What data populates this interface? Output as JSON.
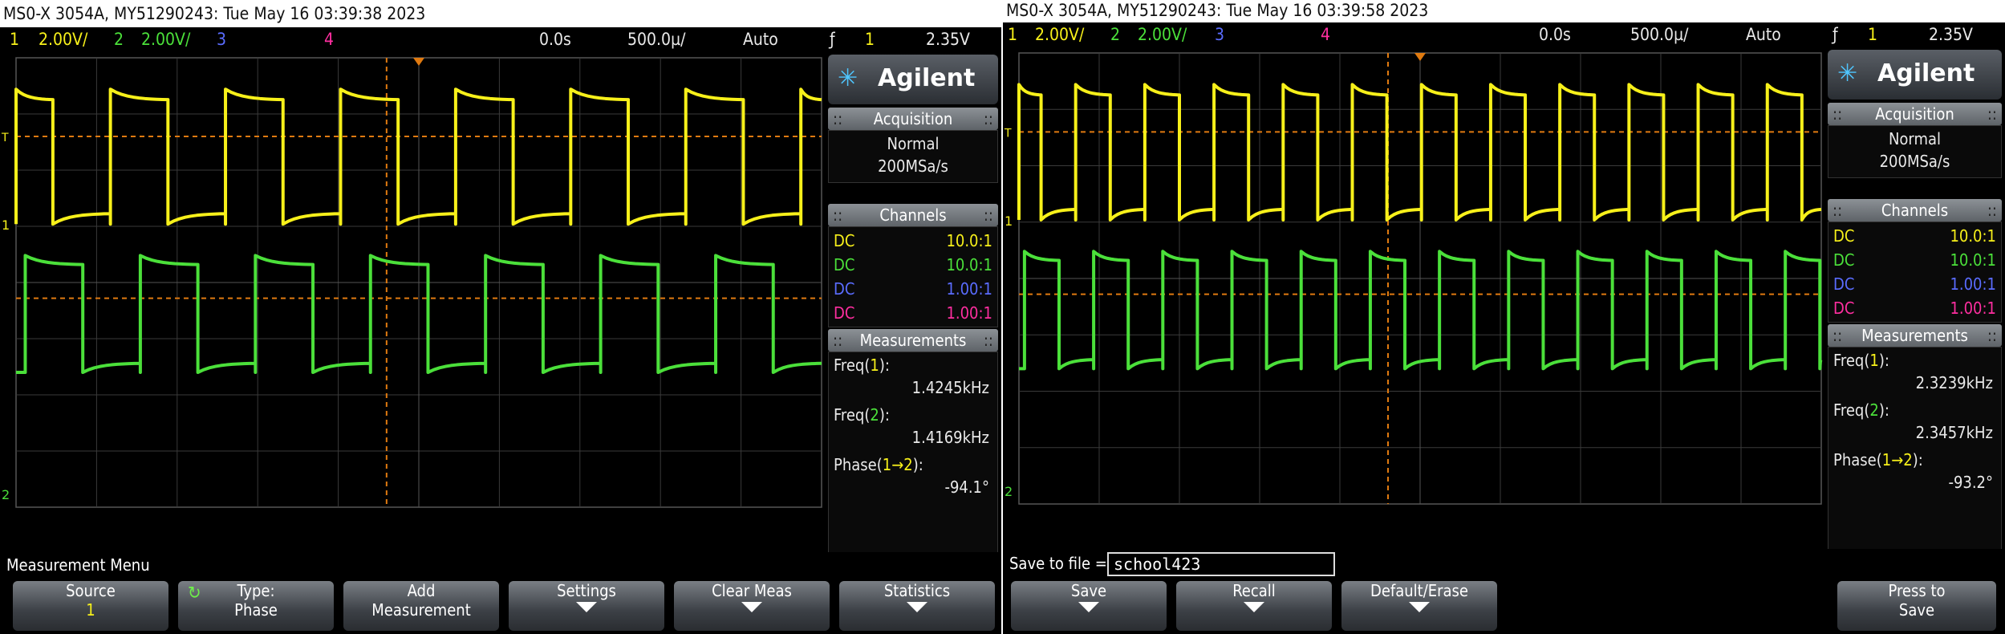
{
  "screens": [
    {
      "title": "MS0-X 3054A, MY51290243: Tue May 16 03:39:38 2023",
      "ch1_num": "1",
      "ch1_scale": "2.00V/",
      "ch2_num": "2",
      "ch2_scale": "2.00V/",
      "ch3_num": "3",
      "ch4_num": "4",
      "time_delay": "0.0s",
      "time_scale": "500.0µ/",
      "trigger_mode": "Auto",
      "trigger_slope": "ƒ",
      "trigger_src": "1",
      "trigger_level": "2.35V",
      "logo": "Agilent",
      "acq_header": "Acquisition",
      "acq_mode": "Normal",
      "acq_rate": "200MSa/s",
      "ch_header": "Channels",
      "channels": [
        {
          "coupling": "DC",
          "probe": "10.0:1"
        },
        {
          "coupling": "DC",
          "probe": "10.0:1"
        },
        {
          "coupling": "DC",
          "probe": "1.00:1"
        },
        {
          "coupling": "DC",
          "probe": "1.00:1"
        }
      ],
      "meas_header": "Measurements",
      "meas": [
        {
          "pre": "Freq(",
          "src": "1",
          "post": "):",
          "value": "1.4245kHz"
        },
        {
          "pre": "Freq(",
          "src": "2",
          "post": "):",
          "value": "1.4169kHz"
        },
        {
          "pre": "Phase(",
          "src": "1→2",
          "post": "):",
          "value": "-94.1°"
        }
      ],
      "menu_title": "Measurement Menu",
      "buttons": [
        {
          "l1": "Source",
          "l2": "1"
        },
        {
          "l1": "Type:",
          "l2": "Phase"
        },
        {
          "l1": "Add",
          "l2": "Measurement"
        },
        {
          "l1": "Settings",
          "l2": ""
        },
        {
          "l1": "Clear Meas",
          "l2": ""
        },
        {
          "l1": "Statistics",
          "l2": ""
        }
      ],
      "trig_marker": "T",
      "gnd1": "1",
      "gnd2": "2"
    },
    {
      "title": "MS0-X 3054A, MY51290243: Tue May 16 03:39:58 2023",
      "ch1_num": "1",
      "ch1_scale": "2.00V/",
      "ch2_num": "2",
      "ch2_scale": "2.00V/",
      "ch3_num": "3",
      "ch4_num": "4",
      "time_delay": "0.0s",
      "time_scale": "500.0µ/",
      "trigger_mode": "Auto",
      "trigger_slope": "ƒ",
      "trigger_src": "1",
      "trigger_level": "2.35V",
      "logo": "Agilent",
      "acq_header": "Acquisition",
      "acq_mode": "Normal",
      "acq_rate": "200MSa/s",
      "ch_header": "Channels",
      "channels": [
        {
          "coupling": "DC",
          "probe": "10.0:1"
        },
        {
          "coupling": "DC",
          "probe": "10.0:1"
        },
        {
          "coupling": "DC",
          "probe": "1.00:1"
        },
        {
          "coupling": "DC",
          "probe": "1.00:1"
        }
      ],
      "meas_header": "Measurements",
      "meas": [
        {
          "pre": "Freq(",
          "src": "1",
          "post": "):",
          "value": "2.3239kHz"
        },
        {
          "pre": "Freq(",
          "src": "2",
          "post": "):",
          "value": "2.3457kHz"
        },
        {
          "pre": "Phase(",
          "src": "1→2",
          "post": "):",
          "value": "-93.2°"
        }
      ],
      "menu_title": "Save to file =",
      "file_name": "school423",
      "buttons": [
        {
          "l1": "Save",
          "l2": ""
        },
        {
          "l1": "Recall",
          "l2": ""
        },
        {
          "l1": "Default/Erase",
          "l2": ""
        },
        {
          "l1": "Press to",
          "l2": "Save"
        }
      ],
      "trig_marker": "T",
      "gnd1": "1",
      "gnd2": "2"
    }
  ],
  "colors": {
    "ch1": "#f7f01a",
    "ch2": "#4be03a",
    "ch3": "#5a6cff",
    "ch4": "#ff2ea0",
    "cursor": "#e07a10"
  },
  "signal": {
    "ch1_periods_per_div": [
      0.7,
      1.16
    ],
    "ch2_delay_fraction": 0.26
  }
}
